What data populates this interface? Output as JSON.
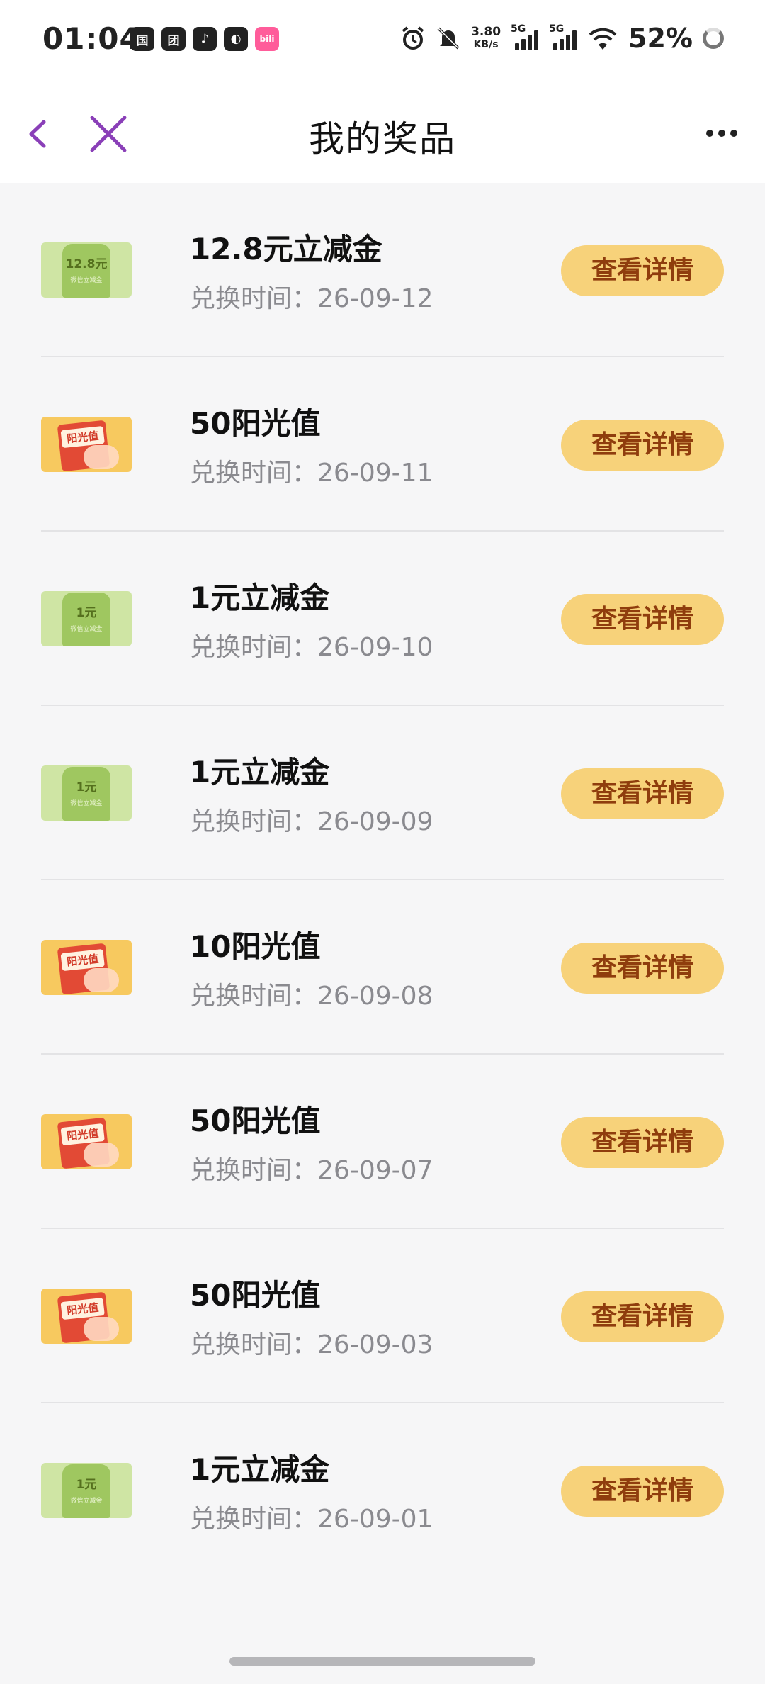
{
  "status_bar": {
    "time": "01:04",
    "app_icons": [
      "国",
      "团",
      "♪",
      "◐",
      "bili"
    ],
    "net_speed_value": "3.80",
    "net_speed_unit": "KB/s",
    "signal_tags": [
      "5G",
      "5G"
    ],
    "battery": "52%"
  },
  "header": {
    "title": "我的奖品"
  },
  "colors": {
    "accent_purple": "#8a3fb8",
    "button_bg": "#f7d27a",
    "button_text": "#8f3d0d"
  },
  "prizes": [
    {
      "name": "12.8元立减金",
      "time_label": "兑换时间：",
      "date": "26-09-12",
      "button": "查看详情",
      "thumb_type": "green",
      "thumb_amount": "12.8元",
      "thumb_sub": "微信立减金"
    },
    {
      "name": "50阳光值",
      "time_label": "兑换时间：",
      "date": "26-09-11",
      "button": "查看详情",
      "thumb_type": "orange",
      "thumb_label": "阳光值"
    },
    {
      "name": "1元立减金",
      "time_label": "兑换时间：",
      "date": "26-09-10",
      "button": "查看详情",
      "thumb_type": "green",
      "thumb_amount": "1元",
      "thumb_sub": "微信立减金"
    },
    {
      "name": "1元立减金",
      "time_label": "兑换时间：",
      "date": "26-09-09",
      "button": "查看详情",
      "thumb_type": "green",
      "thumb_amount": "1元",
      "thumb_sub": "微信立减金"
    },
    {
      "name": "10阳光值",
      "time_label": "兑换时间：",
      "date": "26-09-08",
      "button": "查看详情",
      "thumb_type": "orange",
      "thumb_label": "阳光值"
    },
    {
      "name": "50阳光值",
      "time_label": "兑换时间：",
      "date": "26-09-07",
      "button": "查看详情",
      "thumb_type": "orange",
      "thumb_label": "阳光值"
    },
    {
      "name": "50阳光值",
      "time_label": "兑换时间：",
      "date": "26-09-03",
      "button": "查看详情",
      "thumb_type": "orange",
      "thumb_label": "阳光值"
    },
    {
      "name": "1元立减金",
      "time_label": "兑换时间：",
      "date": "26-09-01",
      "button": "查看详情",
      "thumb_type": "green",
      "thumb_amount": "1元",
      "thumb_sub": "微信立减金"
    }
  ]
}
